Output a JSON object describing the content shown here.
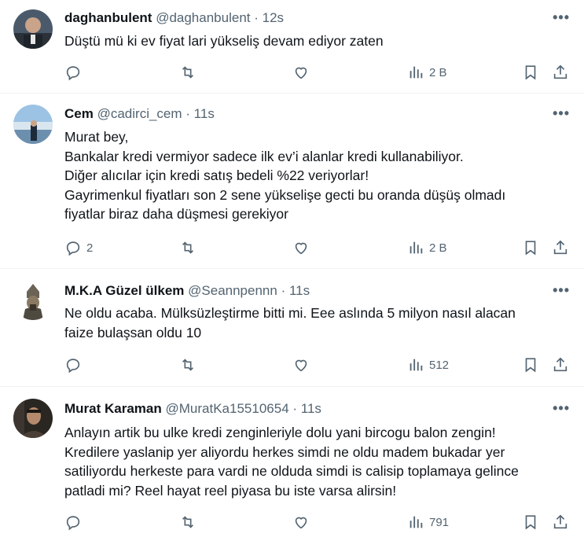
{
  "tweets": [
    {
      "name": "daghanbulent",
      "handle": "@daghanbulent",
      "time": "12s",
      "lines": [
        "Düştü mü ki ev fiyat lari yükseliş devam ediyor zaten"
      ],
      "replies": "",
      "views": "2 B"
    },
    {
      "name": "Cem",
      "handle": "@cadirci_cem",
      "time": "11s",
      "lines": [
        "Murat bey,",
        "Bankalar kredi vermiyor sadece ilk ev’i alanlar kredi kullanabiliyor.",
        "Diğer alıcılar için kredi satış bedeli %22 veriyorlar!",
        "Gayrimenkul fiyatları son 2 sene yükselişe gecti bu oranda düşüş olmadı",
        "fiyatlar biraz daha düşmesi gerekiyor"
      ],
      "replies": "2",
      "views": "2 B"
    },
    {
      "name": "M.K.A Güzel ülkem",
      "handle": "@Seannpennn",
      "time": "11s",
      "lines": [
        "Ne oldu acaba. Mülksüzleştirme bitti mi. Eee aslında 5 milyon nasıl alacan",
        "faize bulaşsan oldu 10"
      ],
      "replies": "",
      "views": "512"
    },
    {
      "name": "Murat Karaman",
      "handle": "@MuratKa15510654",
      "time": "11s",
      "lines": [
        "Anlayın artik bu ulke kredi zenginleriyle dolu yani bircogu balon zengin!",
        "Kredilere yaslanip yer aliyordu herkes simdi ne oldu madem bukadar yer",
        "satiliyordu herkeste para vardi ne olduda simdi is calisip toplamaya gelince",
        "patladi mi? Reel hayat reel piyasa bu iste varsa alirsin!"
      ],
      "replies": "",
      "views": "791"
    }
  ],
  "icons": {
    "more": "more-icon",
    "reply": "reply-icon",
    "retweet": "retweet-icon",
    "like": "like-icon",
    "views": "views-icon",
    "bookmark": "bookmark-icon",
    "share": "share-icon"
  },
  "colors": {
    "text": "#0f1419",
    "muted": "#536471",
    "divider": "#eff3f4"
  }
}
